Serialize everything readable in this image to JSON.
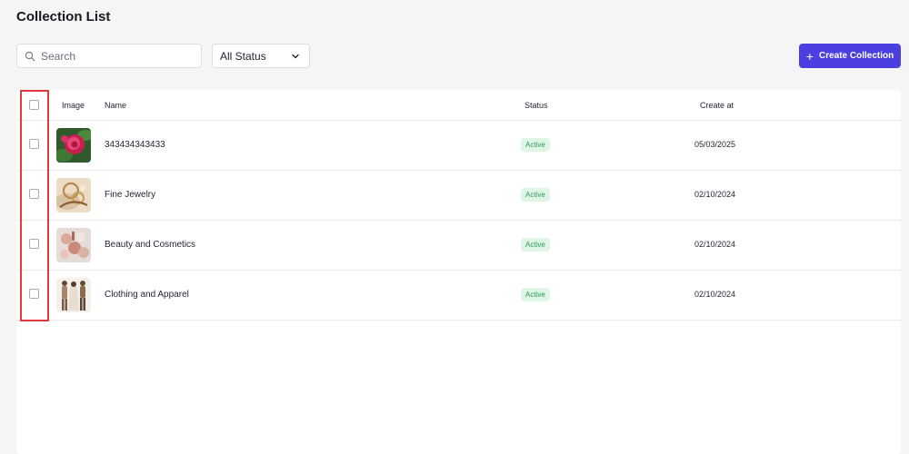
{
  "page": {
    "title": "Collection List"
  },
  "toolbar": {
    "search_placeholder": "Search",
    "status_filter": "All Status",
    "create_label": "Create Collection"
  },
  "table": {
    "columns": {
      "image": "Image",
      "name": "Name",
      "status": "Status",
      "created": "Create at"
    },
    "rows": [
      {
        "name": "343434343433",
        "status": "Active",
        "created": "05/03/2025",
        "thumb": "rose-image"
      },
      {
        "name": "Fine Jewelry",
        "status": "Active",
        "created": "02/10/2024",
        "thumb": "jewelry-image"
      },
      {
        "name": "Beauty and Cosmetics",
        "status": "Active",
        "created": "02/10/2024",
        "thumb": "cosmetics-image"
      },
      {
        "name": "Clothing and Apparel",
        "status": "Active",
        "created": "02/10/2024",
        "thumb": "apparel-image"
      }
    ]
  },
  "colors": {
    "accent": "#4b3fe0",
    "active_badge_bg": "#dff5e6",
    "active_badge_text": "#2f9a57",
    "highlight": "#e0393e"
  }
}
